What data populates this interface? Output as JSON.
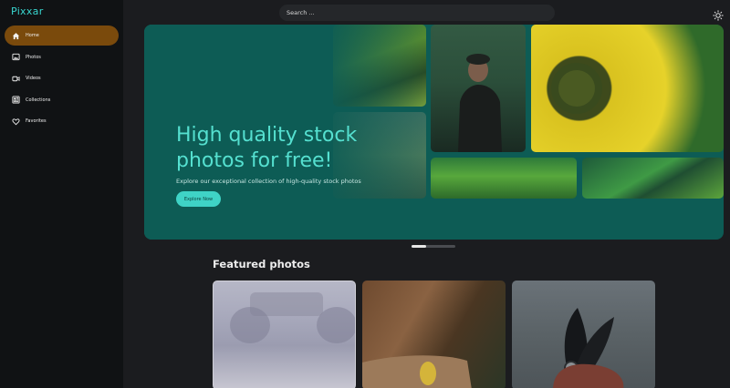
{
  "app": {
    "title": "Pixxar"
  },
  "sidebar": {
    "items": [
      {
        "label": "Home",
        "icon": "home-icon",
        "active": true
      },
      {
        "label": "Photos",
        "icon": "image-icon",
        "active": false
      },
      {
        "label": "Videos",
        "icon": "video-icon",
        "active": false
      },
      {
        "label": "Collections",
        "icon": "collection-icon",
        "active": false
      },
      {
        "label": "Favorites",
        "icon": "heart-icon",
        "active": false
      }
    ]
  },
  "search": {
    "placeholder": "Search ..."
  },
  "hero": {
    "title": "High quality stock photos for free!",
    "subtitle": "Explore our exceptional collection of high-quality stock photos",
    "cta": "Explore Now"
  },
  "featured": {
    "title": "Featured photos"
  },
  "colors": {
    "accent": "#38d6cf",
    "active_nav": "#7a4a0c",
    "hero_bg": "#0d5c55"
  }
}
